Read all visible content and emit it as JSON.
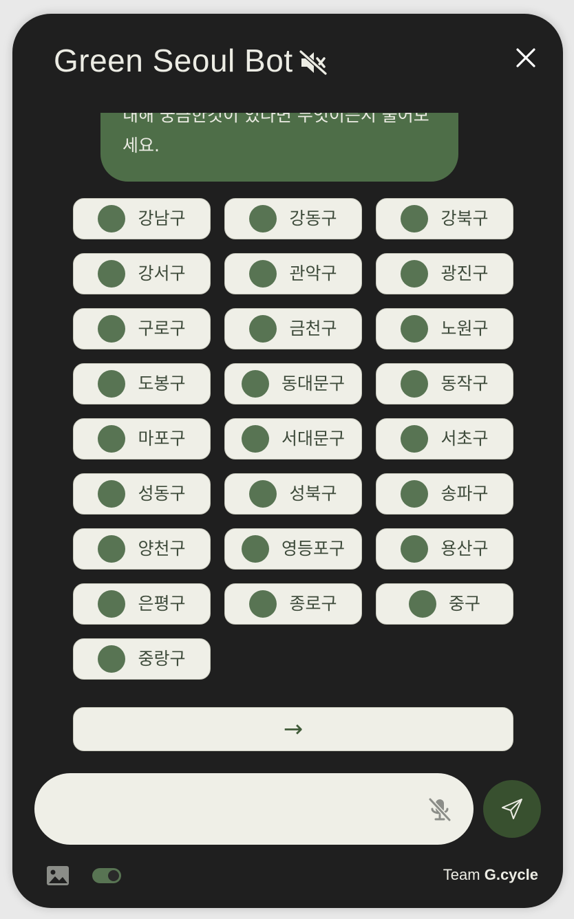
{
  "header": {
    "title": "Green Seoul Bot",
    "mute_icon": "speaker-muted-icon",
    "close_icon": "close-icon"
  },
  "chat": {
    "bubble_text": "내해 궁금한것이 있다면 무엇이든지 물어보세요.",
    "bubble_color": "#4e6e48",
    "districts": [
      "강남구",
      "강동구",
      "강북구",
      "강서구",
      "관악구",
      "광진구",
      "구로구",
      "금천구",
      "노원구",
      "도봉구",
      "동대문구",
      "동작구",
      "마포구",
      "서대문구",
      "서초구",
      "성동구",
      "성북구",
      "송파구",
      "양천구",
      "영등포구",
      "용산구",
      "은평구",
      "종로구",
      "중구",
      "중랑구"
    ],
    "next_button": "→"
  },
  "composer": {
    "input_value": "",
    "mic_icon": "microphone-muted-icon",
    "send_icon": "paper-plane-icon",
    "send_color": "#38502f"
  },
  "footer": {
    "image_icon": "image-icon",
    "toggle_on": true,
    "credit_prefix": "Team",
    "credit_name": "G.cycle"
  },
  "colors": {
    "background": "#1f1f1f",
    "chip": "#efefe7",
    "accent": "#587453"
  }
}
